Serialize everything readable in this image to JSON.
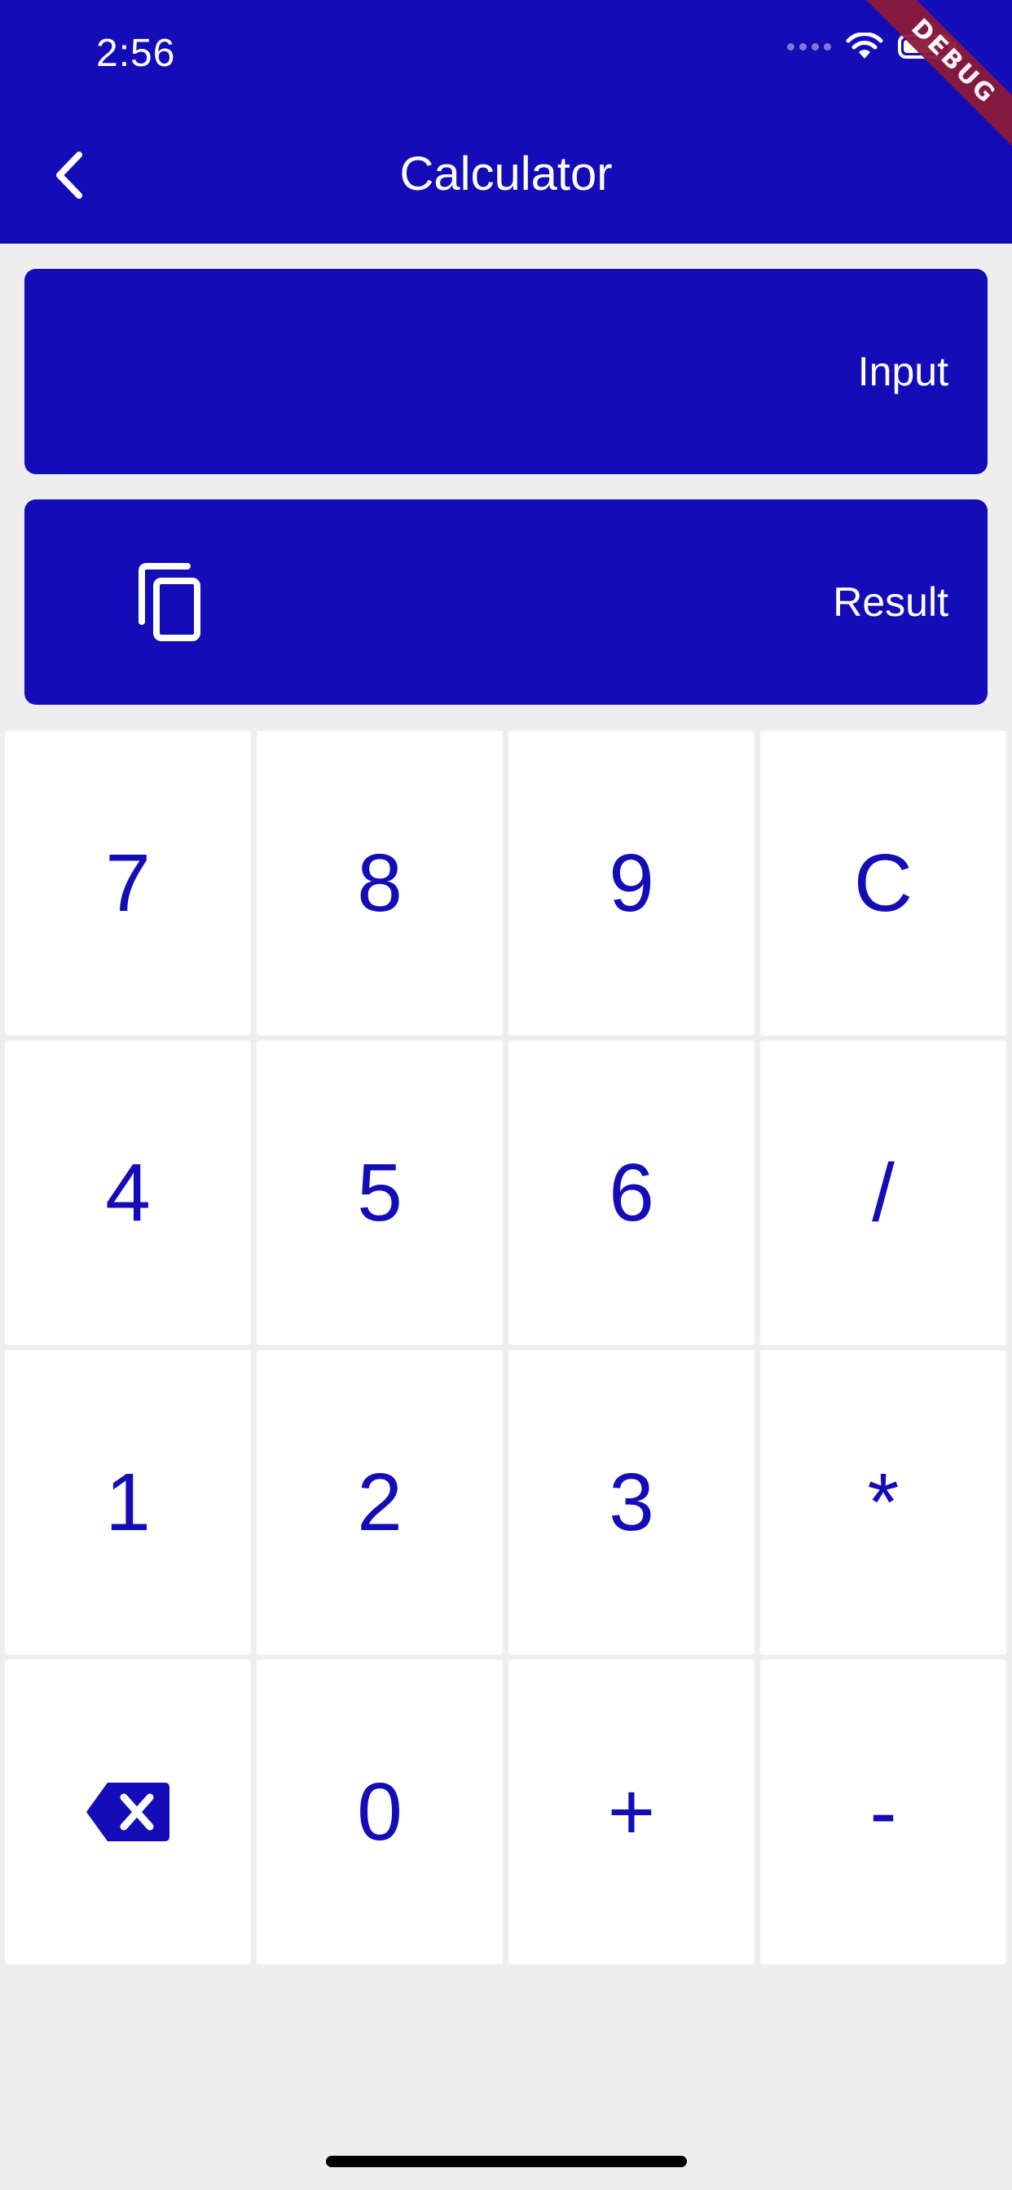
{
  "status_bar": {
    "time": "2:56",
    "icons": [
      "signal-icon",
      "wifi-icon",
      "battery-icon"
    ]
  },
  "debug_banner": "DEBUG",
  "app_bar": {
    "title": "Calculator",
    "back_icon": "chevron-left-icon"
  },
  "display": {
    "input_label": "Input",
    "result_label": "Result",
    "copy_icon": "copy-icon"
  },
  "keypad": {
    "keys": [
      {
        "label": "7",
        "name": "key-7"
      },
      {
        "label": "8",
        "name": "key-8"
      },
      {
        "label": "9",
        "name": "key-9"
      },
      {
        "label": "C",
        "name": "key-clear"
      },
      {
        "label": "4",
        "name": "key-4"
      },
      {
        "label": "5",
        "name": "key-5"
      },
      {
        "label": "6",
        "name": "key-6"
      },
      {
        "label": "/",
        "name": "key-divide"
      },
      {
        "label": "1",
        "name": "key-1"
      },
      {
        "label": "2",
        "name": "key-2"
      },
      {
        "label": "3",
        "name": "key-3"
      },
      {
        "label": "*",
        "name": "key-multiply"
      },
      {
        "label": "",
        "name": "key-backspace",
        "icon": "backspace-icon"
      },
      {
        "label": "0",
        "name": "key-0"
      },
      {
        "label": "+",
        "name": "key-plus"
      },
      {
        "label": "-",
        "name": "key-minus"
      }
    ]
  },
  "colors": {
    "primary": "#130cb7",
    "background": "#eeeeee",
    "key_background": "#ffffff",
    "debug_ribbon": "#8b1a3a"
  }
}
